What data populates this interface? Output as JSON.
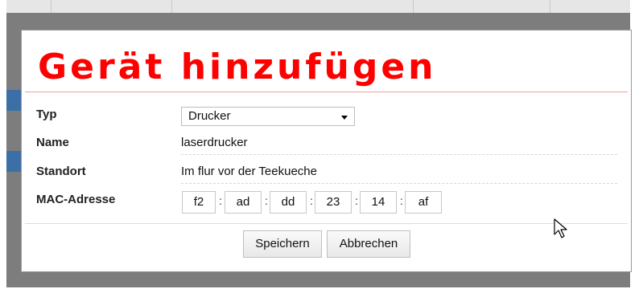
{
  "dialog": {
    "title": "Gerät hinzufügen",
    "title_color": "#ff0000",
    "fields": {
      "typ": {
        "label": "Typ",
        "selected": "Drucker"
      },
      "name": {
        "label": "Name",
        "value": "laserdrucker"
      },
      "standort": {
        "label": "Standort",
        "value": "Im flur vor der Teekueche"
      },
      "mac": {
        "label": "MAC-Adresse",
        "octets": [
          "f2",
          "ad",
          "dd",
          "23",
          "14",
          "af"
        ],
        "separator": ":"
      }
    },
    "buttons": {
      "save": "Speichern",
      "cancel": "Abbrechen"
    }
  },
  "icons": {
    "cursor": "mouse-pointer-icon",
    "select_caret": "chevron-down-icon"
  }
}
